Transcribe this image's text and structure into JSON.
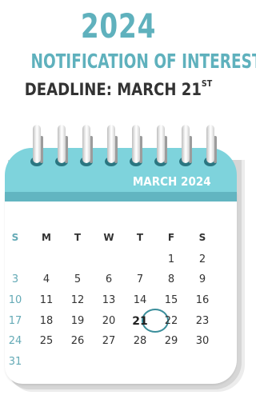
{
  "header": {
    "year": "2024",
    "subtitle": "NOTIFICATION OF INTEREST",
    "deadline_prefix": "DEADLINE: MARCH 21",
    "deadline_suffix": "ST"
  },
  "calendar": {
    "month_label": "MARCH 2024",
    "day_names": [
      "S",
      "M",
      "T",
      "W",
      "T",
      "F",
      "S"
    ],
    "weeks": [
      [
        "",
        "",
        "",
        "",
        "",
        "1",
        "2"
      ],
      [
        "3",
        "4",
        "5",
        "6",
        "7",
        "8",
        "9"
      ],
      [
        "10",
        "11",
        "12",
        "13",
        "14",
        "15",
        "16"
      ],
      [
        "17",
        "18",
        "19",
        "20",
        "21",
        "22",
        "23"
      ],
      [
        "24",
        "25",
        "26",
        "27",
        "28",
        "29",
        "30"
      ],
      [
        "31",
        "",
        "",
        "",
        "",
        "",
        ""
      ]
    ],
    "highlighted_day": "21",
    "colors": {
      "accent": "#5fb1bd",
      "header": "#7ed3dc",
      "highlight_ring": "#3a8e9b"
    }
  }
}
